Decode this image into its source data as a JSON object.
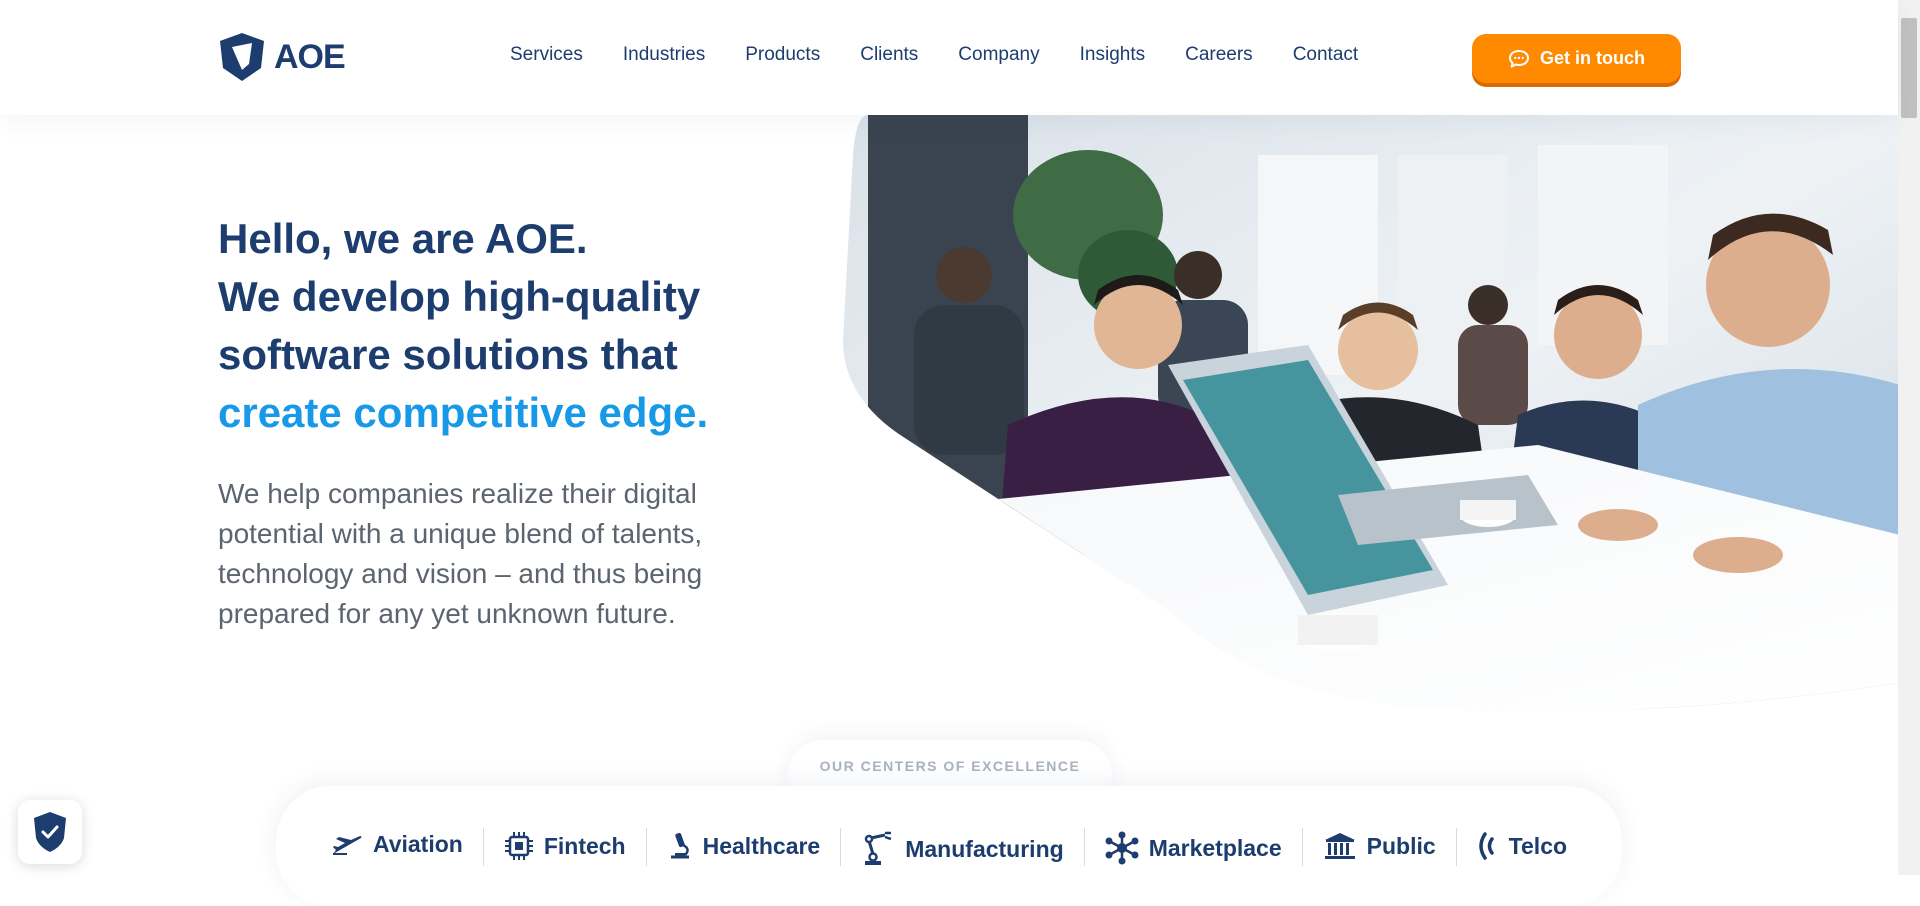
{
  "brand": {
    "name": "AOE"
  },
  "nav": {
    "items": [
      "Services",
      "Industries",
      "Products",
      "Clients",
      "Company",
      "Insights",
      "Careers",
      "Contact"
    ]
  },
  "cta": {
    "label": "Get in touch",
    "icon": "chat-bubble-icon"
  },
  "hero": {
    "line1": "Hello, we are AOE.",
    "line2": "We develop high-quality",
    "line3": "software solutions that",
    "line4": "create competitive edge.",
    "paragraph": "We help companies realize their digital potential with a unique blend of talents, technology and vision – and thus being prepared for any yet unknown future."
  },
  "centers": {
    "label": "OUR CENTERS OF EXCELLENCE",
    "items": [
      {
        "label": "Aviation",
        "icon": "airplane-icon"
      },
      {
        "label": "Fintech",
        "icon": "chip-icon"
      },
      {
        "label": "Healthcare",
        "icon": "microscope-icon"
      },
      {
        "label": "Manufacturing",
        "icon": "robot-arm-icon"
      },
      {
        "label": "Marketplace",
        "icon": "network-icon"
      },
      {
        "label": "Public",
        "icon": "building-icon"
      },
      {
        "label": "Telco",
        "icon": "signal-icon"
      }
    ]
  },
  "colors": {
    "primary": "#1c3d6e",
    "accent": "#1799e8",
    "cta": "#ff8a00"
  }
}
